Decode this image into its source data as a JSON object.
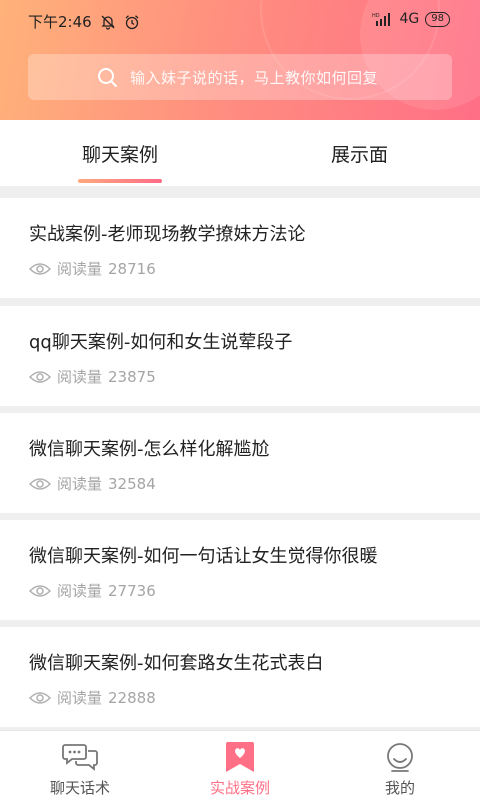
{
  "status_bar": {
    "time": "下午2:46",
    "network": "4G",
    "battery": "98",
    "icons": [
      "mute-bell-icon",
      "alarm-icon",
      "hd-signal-icon",
      "battery-icon"
    ]
  },
  "search": {
    "placeholder": "输入妹子说的话，马上教你如何回复",
    "icon": "search-icon"
  },
  "tabs": [
    {
      "label": "聊天案例",
      "active": true
    },
    {
      "label": "展示面",
      "active": false
    }
  ],
  "articles": [
    {
      "title": "实战案例-老师现场教学撩妹方法论",
      "views_label": "阅读量",
      "views": "28716"
    },
    {
      "title": "qq聊天案例-如何和女生说荤段子",
      "views_label": "阅读量",
      "views": "23875"
    },
    {
      "title": "微信聊天案例-怎么样化解尴尬",
      "views_label": "阅读量",
      "views": "32584"
    },
    {
      "title": "微信聊天案例-如何一句话让女生觉得你很暖",
      "views_label": "阅读量",
      "views": "27736"
    },
    {
      "title": "微信聊天案例-如何套路女生花式表白",
      "views_label": "阅读量",
      "views": "22888"
    }
  ],
  "bottom_nav": [
    {
      "label": "聊天话术",
      "icon": "chat-bubbles-icon",
      "active": false
    },
    {
      "label": "实战案例",
      "icon": "bookmark-heart-icon",
      "active": true
    },
    {
      "label": "我的",
      "icon": "smiley-face-icon",
      "active": false
    }
  ],
  "colors": {
    "accent": "#ff6f86",
    "gradient_start": "#ffb27a",
    "gradient_end": "#ff6f86",
    "meta_text": "#a5a5a5"
  }
}
